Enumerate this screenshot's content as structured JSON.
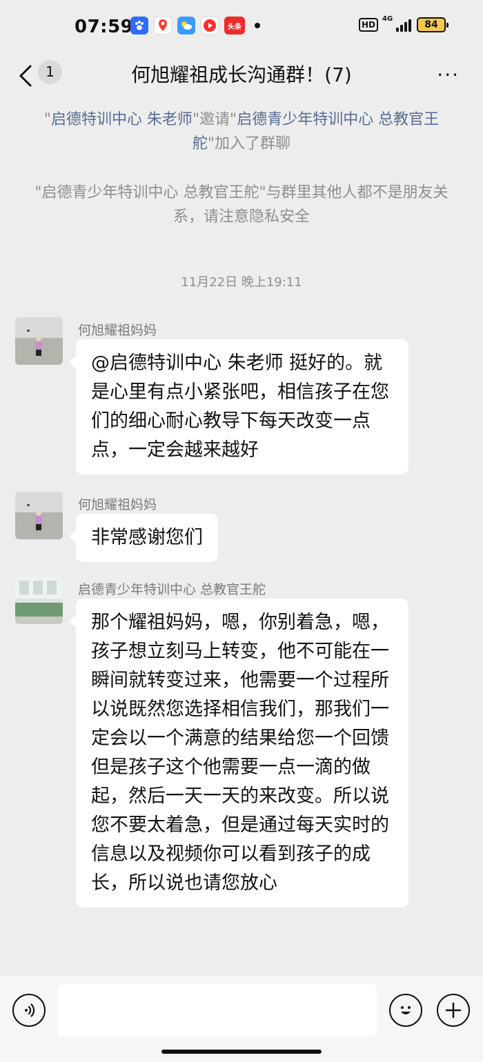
{
  "status_bar": {
    "time": "07:59",
    "apps": [
      {
        "icon": "baidu-icon",
        "color": "#2f6bff"
      },
      {
        "icon": "map-pin-icon",
        "color": "#ff3b30"
      },
      {
        "icon": "weather-icon",
        "color": "#3a9cff"
      },
      {
        "icon": "video-icon",
        "color": "#ff2d2d"
      },
      {
        "icon": "toutiao-icon",
        "color": "#ee2a2a",
        "label": "头条"
      }
    ],
    "hd": "HD",
    "network": "4G",
    "battery": "84"
  },
  "nav": {
    "unread_count": "1",
    "title": "何旭耀祖成长沟通群！(7)",
    "more": "···"
  },
  "system_messages": {
    "invite": {
      "q1": "\"",
      "inviter": "启德特训中心  朱老师",
      "q2": "\"邀请\"",
      "invitee": "启德青少年特训中心 总教官王舵",
      "q3": "\"加入了群聊"
    },
    "notice": "\"启德青少年特训中心 总教官王舵\"与群里其他人都不是朋友关系，请注意隐私安全"
  },
  "timestamp": "11月22日 晚上19:11",
  "messages": [
    {
      "sender": "何旭耀祖妈妈",
      "text": "@启德特训中心  朱老师  挺好的。就是心里有点小紧张吧，相信孩子在您们的细心耐心教导下每天改变一点点，一定会越来越好"
    },
    {
      "sender": "何旭耀祖妈妈",
      "text": "非常感谢您们"
    },
    {
      "sender": "启德青少年特训中心 总教官王舵",
      "text": "那个耀祖妈妈，嗯，你别着急，嗯，孩子想立刻马上转变，他不可能在一瞬间就转变过来，他需要一个过程所以说既然您选择相信我们，那我们一定会以一个满意的结果给您一个回馈但是孩子这个他需要一点一滴的做起，然后一天一天的来改变。所以说您不要太着急，但是通过每天实时的信息以及视频你可以看到孩子的成长，所以说也请您放心"
    }
  ],
  "input": {
    "placeholder": ""
  }
}
